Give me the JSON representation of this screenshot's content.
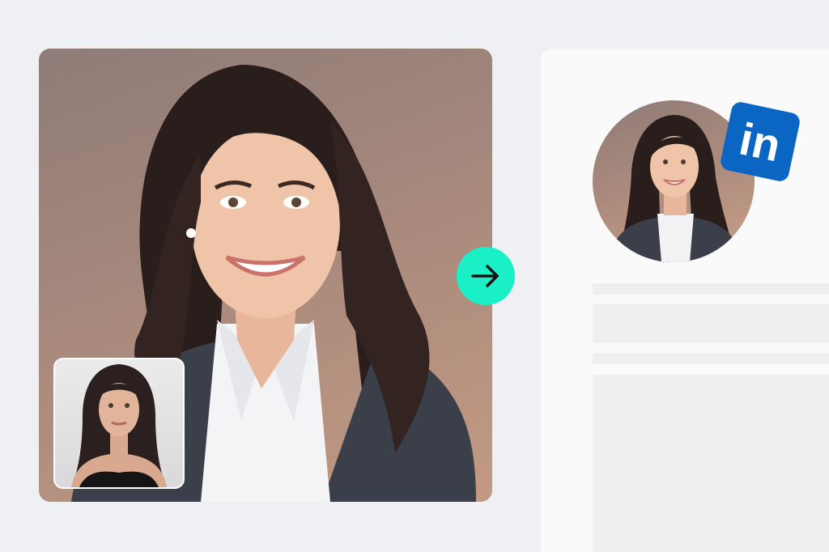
{
  "hero": {
    "caption": ""
  },
  "thumbnail": {
    "caption": ""
  },
  "arrow_button": {
    "icon": "arrow-right-icon"
  },
  "profile": {
    "badge": {
      "text": "in",
      "color": "#0a66c2"
    }
  },
  "colors": {
    "background": "#eef0f3",
    "accent": "#19f0c6",
    "card": "#fafafa",
    "placeholder": "#eeeff1"
  }
}
